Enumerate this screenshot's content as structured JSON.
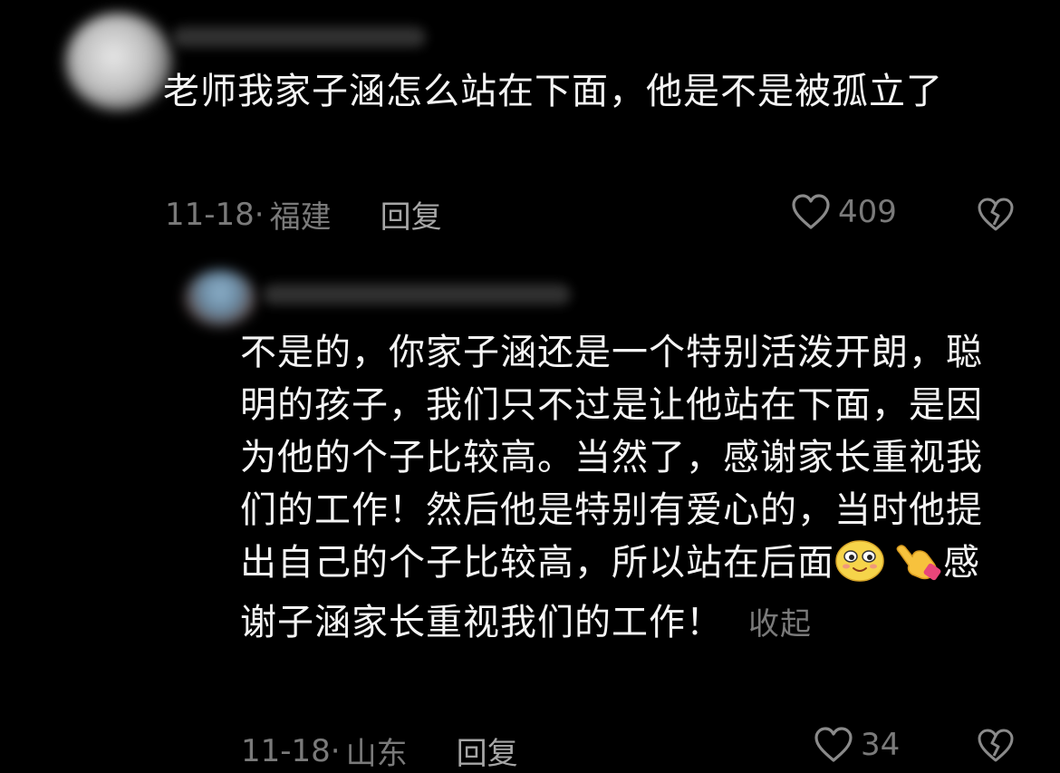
{
  "comments": [
    {
      "text": "老师我家子涵怎么站在下面，他是不是被孤立了",
      "date": "11-18",
      "location": "福建",
      "reply_label": "回复",
      "likes": "409"
    },
    {
      "text_part1": "不是的，你家子涵还是一个特别活泼开朗，聪明的孩子，我们只不过是让他站在下面，是因为他的个子比较高。当然了，感谢家长重视我们的工作！然后他是特别有爱心的，当时他提出自己的个子比较高，所以站在后面",
      "text_part2": "感谢子涵家长重视我们的工作！",
      "collapse_label": "收起",
      "date": "11-18",
      "location": "山东",
      "reply_label": "回复",
      "likes": "34"
    }
  ],
  "icons": {
    "like": "heart-outline-icon",
    "dislike": "broken-heart-icon",
    "emoji1": "smiling-face-emoji",
    "emoji2": "pointing-hand-emoji"
  },
  "colors": {
    "background": "#000000",
    "text": "#f4f4f4",
    "meta": "#7a7a7a"
  }
}
